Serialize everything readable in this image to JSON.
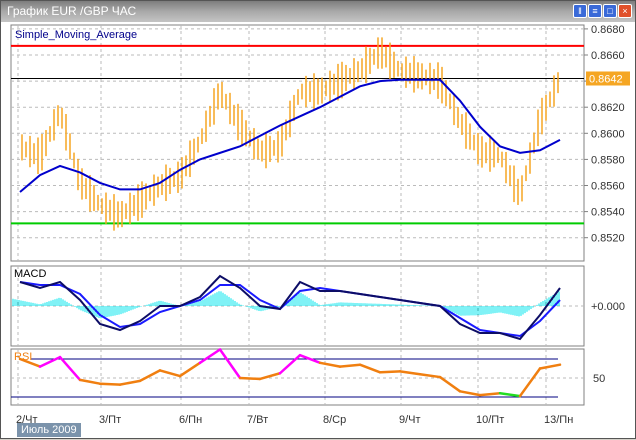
{
  "window": {
    "title": "График EUR /GBP  ЧАС",
    "buttons": [
      "tile",
      "cascade",
      "maximize",
      "close"
    ]
  },
  "main": {
    "indicator_label": "Simple_Moving_Average",
    "current_price_label": "0.8642",
    "price_ticks": [
      "0.8680",
      "0.8660",
      "0.8640",
      "0.8620",
      "0.8600",
      "0.8580",
      "0.8560",
      "0.8540",
      "0.8520"
    ],
    "red_level": 0.8667,
    "green_level": 0.8531,
    "current_price": 0.8642,
    "colors": {
      "price": "#f5a623",
      "sma": "#0000cc",
      "red": "#ff0000",
      "green": "#00cc00"
    }
  },
  "macd": {
    "label": "MACD",
    "zero_label": "+0.000"
  },
  "rsi": {
    "label": "RSI",
    "level_label": "50",
    "upper": 70,
    "lower": 30
  },
  "x_axis": {
    "month_label": "Июль 2009",
    "dates": [
      "2/Чт",
      "3/Пт",
      "6/Пн",
      "7/Вт",
      "8/Ср",
      "9/Чт",
      "10/Пт",
      "13/Пн"
    ]
  },
  "chart_data": {
    "type": "line",
    "price": [
      0.859,
      0.8582,
      0.8617,
      0.8563,
      0.8545,
      0.8537,
      0.8548,
      0.856,
      0.8567,
      0.8594,
      0.8632,
      0.8606,
      0.8586,
      0.859,
      0.8632,
      0.8632,
      0.864,
      0.8648,
      0.8663,
      0.8648,
      0.8644,
      0.864,
      0.8609,
      0.8586,
      0.8583,
      0.8552,
      0.861,
      0.8642
    ],
    "sma": [
      0.8555,
      0.8568,
      0.8575,
      0.857,
      0.8562,
      0.8557,
      0.8557,
      0.8562,
      0.8572,
      0.858,
      0.8585,
      0.859,
      0.8598,
      0.8606,
      0.8613,
      0.862,
      0.8628,
      0.8636,
      0.864,
      0.8641,
      0.8641,
      0.8641,
      0.8625,
      0.8605,
      0.859,
      0.8585,
      0.8587,
      0.8595
    ],
    "macd_main": [
      0.8,
      0.6,
      0.8,
      0.2,
      -0.6,
      -0.8,
      -0.5,
      0.0,
      0.0,
      0.3,
      1.0,
      0.6,
      0.0,
      -0.1,
      0.8,
      0.5,
      0.5,
      0.4,
      0.3,
      0.2,
      0.1,
      0.0,
      -0.6,
      -0.9,
      -0.9,
      -1.1,
      -0.3,
      0.6
    ],
    "macd_signal": [
      0.8,
      0.7,
      0.7,
      0.4,
      -0.3,
      -0.7,
      -0.6,
      -0.2,
      0.0,
      0.2,
      0.7,
      0.7,
      0.2,
      -0.1,
      0.5,
      0.6,
      0.5,
      0.4,
      0.3,
      0.2,
      0.1,
      0.0,
      -0.4,
      -0.8,
      -0.9,
      -1.0,
      -0.5,
      0.2
    ],
    "rsi": [
      70,
      62,
      72,
      48,
      44,
      43,
      47,
      58,
      52,
      66,
      80,
      50,
      49,
      55,
      74,
      66,
      62,
      64,
      56,
      57,
      54,
      51,
      36,
      32,
      34,
      31,
      60,
      64
    ]
  }
}
